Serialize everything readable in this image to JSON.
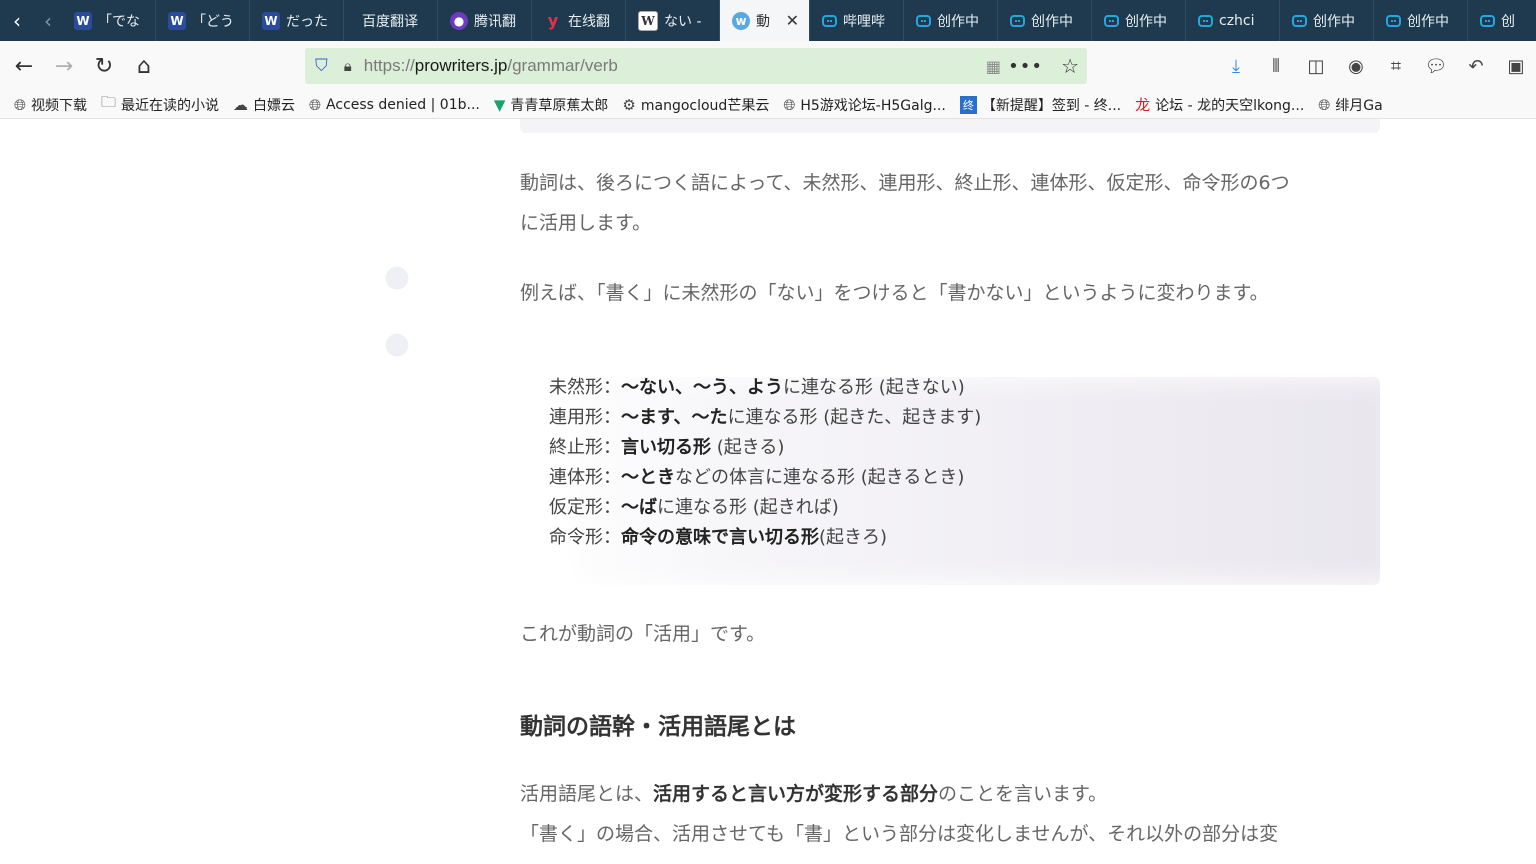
{
  "tabs": [
    {
      "icon": "word-icon",
      "label": "「でな"
    },
    {
      "icon": "word-icon",
      "label": "「どう"
    },
    {
      "icon": "word-icon",
      "label": "だった"
    },
    {
      "icon": "none",
      "label": "百度翻译"
    },
    {
      "icon": "tencent-icon",
      "label": "腾讯翻"
    },
    {
      "icon": "youdao-icon",
      "label": "在线翻"
    },
    {
      "icon": "wiki-icon",
      "label": "ない -"
    },
    {
      "icon": "site-icon",
      "label": "動",
      "active": true
    },
    {
      "icon": "bilibili-icon",
      "label": "哔哩哔"
    },
    {
      "icon": "bilibili-icon",
      "label": "创作中"
    },
    {
      "icon": "bilibili-icon",
      "label": "创作中"
    },
    {
      "icon": "bilibili-icon",
      "label": "创作中"
    },
    {
      "icon": "bilibili-icon",
      "label": "czhci"
    },
    {
      "icon": "bilibili-icon",
      "label": "创作中"
    },
    {
      "icon": "bilibili-icon",
      "label": "创作中"
    },
    {
      "icon": "bilibili-icon",
      "label": "创"
    }
  ],
  "url": {
    "scheme": "https://",
    "host": "prowriters.jp",
    "path": "/grammar/verb"
  },
  "bookmarks": [
    {
      "icon": "globe-icon",
      "label": "视频下载"
    },
    {
      "icon": "folder-icon",
      "label": "最近在读的小说"
    },
    {
      "icon": "cloud-icon",
      "label": "白嫖云"
    },
    {
      "icon": "globe-icon",
      "label": "Access denied | 01b..."
    },
    {
      "icon": "v-icon",
      "label": "青青草原蕉太郎"
    },
    {
      "icon": "gear-icon",
      "label": "mangocloud芒果云"
    },
    {
      "icon": "globe-icon",
      "label": "H5游戏论坛-H5Galg..."
    },
    {
      "icon": "blue-square-icon",
      "label": "【新提醒】签到 - 终..."
    },
    {
      "icon": "dragon-icon",
      "label": "论坛 - 龙的天空lkong..."
    },
    {
      "icon": "globe-icon",
      "label": "绯月Ga"
    }
  ],
  "article": {
    "para1_line1": "動詞は、後ろにつく語によって、未然形、連用形、終止形、連体形、仮定形、命令形の6つ",
    "para1_line2": "に活用します。",
    "para2": "例えば、「書く」に未然形の「ない」をつけると「書かない」というように変わります。",
    "forms": [
      {
        "name": "未然形：",
        "bold": "〜ない、〜う、よう",
        "rest": "に連なる形 (起きない)"
      },
      {
        "name": "連用形：",
        "bold": "〜ます、〜た",
        "rest": "に連なる形 (起きた、起きます)"
      },
      {
        "name": "終止形：",
        "bold": "言い切る形",
        "rest": " (起きる)"
      },
      {
        "name": "連体形：",
        "bold": "〜とき",
        "rest": "などの体言に連なる形 (起きるとき)"
      },
      {
        "name": "仮定形：",
        "bold": "〜ば",
        "rest": "に連なる形 (起きれば)"
      },
      {
        "name": "命令形：",
        "bold": "命令の意味で言い切る形",
        "rest": "(起きろ)"
      }
    ],
    "para3": "これが動詞の「活用」です。",
    "heading": "動詞の語幹・活用語尾とは",
    "para4_pre": "活用語尾とは、",
    "para4_bold": "活用すると言い方が変形する部分",
    "para4_post": "のことを言います。",
    "para5": "「書く」の場合、活用させても「書」という部分は変化しませんが、それ以外の部分は変"
  }
}
